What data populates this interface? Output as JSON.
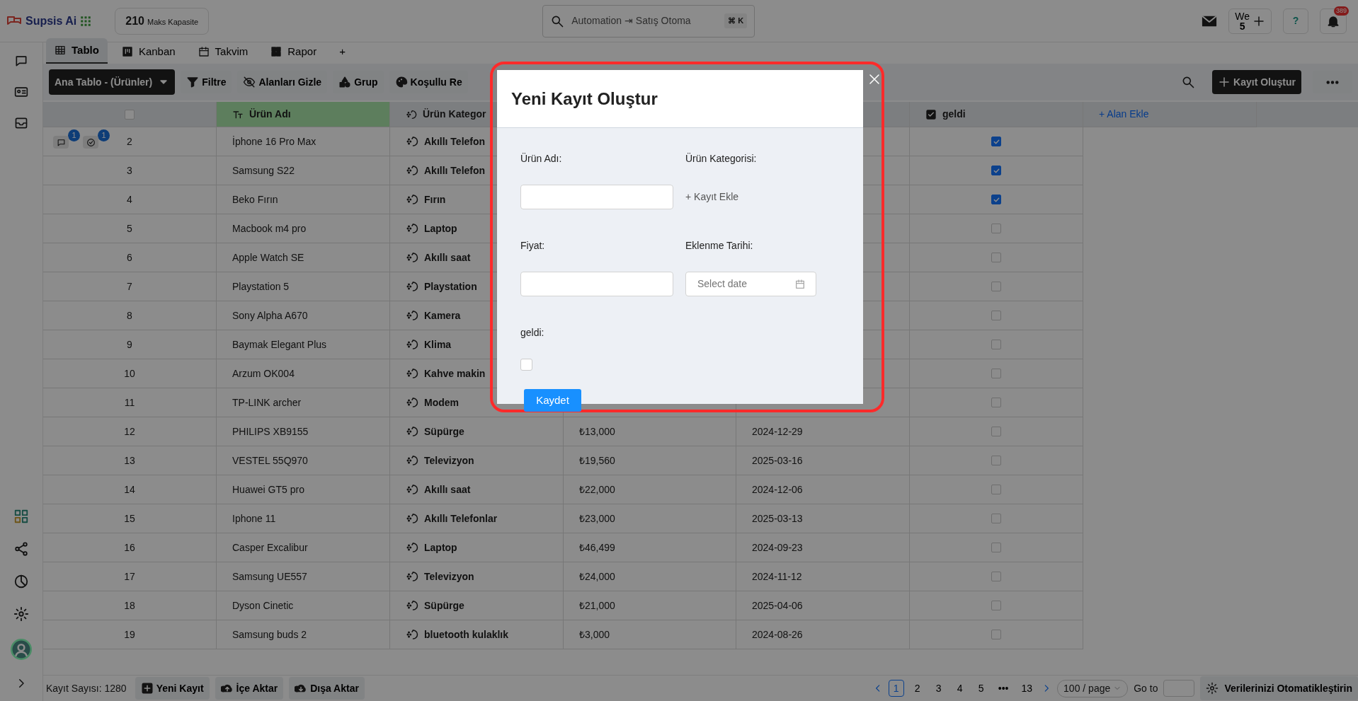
{
  "app": {
    "logo": "Supsis Ai",
    "capacity_value": "210",
    "capacity_label": "Maks Kapasite",
    "search_value": "Automation ⇥ Satış Otoma",
    "search_shortcut": "⌘ K",
    "user_initials": "We",
    "user_count": "5",
    "help": "?",
    "notifications": "389"
  },
  "view_tabs": [
    {
      "label": "Tablo",
      "selected": true
    },
    {
      "label": "Kanban",
      "selected": false
    },
    {
      "label": "Takvim",
      "selected": false
    },
    {
      "label": "Rapor",
      "selected": false
    }
  ],
  "add_tab": "+",
  "toolbar": {
    "table_select": "Ana Tablo - (Ürünler)",
    "buttons": [
      {
        "kind": "filter",
        "label": "Filtre"
      },
      {
        "kind": "hide",
        "label": "Alanları Gizle"
      },
      {
        "kind": "group",
        "label": "Grup"
      },
      {
        "kind": "color",
        "label": "Koşullu Re"
      }
    ],
    "create_button": "Kayıt Oluştur"
  },
  "table": {
    "select_all": {
      "checked": false
    },
    "columns": [
      {
        "label": "Ürün Adı",
        "highlighted": true
      },
      {
        "label": "Ürün Kategor",
        "highlighted": false
      },
      {
        "label": "geldi",
        "highlighted": false
      }
    ],
    "add_field": "+ Alan Ekle",
    "rows": [
      {
        "number": "2",
        "name": "İphone 16 Pro Max",
        "category": "Akıllı Telefon",
        "geldi": true,
        "comments": "1",
        "tasks": "1"
      },
      {
        "number": "3",
        "name": "Samsung S22",
        "category": "Akıllı Telefon",
        "geldi": true
      },
      {
        "number": "4",
        "name": "Beko Fırın",
        "category": "Fırın",
        "geldi": true
      },
      {
        "number": "5",
        "name": "Macbook m4 pro",
        "category": "Laptop",
        "geldi": false
      },
      {
        "number": "6",
        "name": "Apple Watch SE",
        "category": "Akıllı saat",
        "geldi": false
      },
      {
        "number": "7",
        "name": "Playstation 5",
        "category": "Playstation",
        "geldi": false
      },
      {
        "number": "8",
        "name": "Sony Alpha A670",
        "category": "Kamera",
        "geldi": false
      },
      {
        "number": "9",
        "name": "Baymak Elegant Plus",
        "category": "Klima",
        "geldi": false
      },
      {
        "number": "10",
        "name": "Arzum OK004",
        "category": "Kahve makin",
        "geldi": false
      },
      {
        "number": "11",
        "name": "TP-LINK archer",
        "category": "Modem",
        "geldi": false
      },
      {
        "number": "12",
        "name": "PHILIPS XB9155",
        "category": "Süpürge",
        "price": "₺13,000",
        "date": "2024-12-29",
        "geldi": false
      },
      {
        "number": "13",
        "name": "VESTEL 55Q970",
        "category": "Televizyon",
        "price": "₺19,560",
        "date": "2025-03-16",
        "geldi": false
      },
      {
        "number": "14",
        "name": "Huawei GT5 pro",
        "category": "Akıllı saat",
        "price": "₺22,000",
        "date": "2024-12-06",
        "geldi": false
      },
      {
        "number": "15",
        "name": "Iphone 11",
        "category": "Akıllı Telefonlar",
        "price": "₺23,000",
        "date": "2025-03-13",
        "geldi": false
      },
      {
        "number": "16",
        "name": "Casper Excalibur",
        "category": "Laptop",
        "price": "₺46,499",
        "date": "2024-09-23",
        "geldi": false
      },
      {
        "number": "17",
        "name": "Samsung UE557",
        "category": "Televizyon",
        "price": "₺24,000",
        "date": "2024-11-12",
        "geldi": false
      },
      {
        "number": "18",
        "name": "Dyson Cinetic",
        "category": "Süpürge",
        "price": "₺21,000",
        "date": "2025-04-06",
        "geldi": false
      },
      {
        "number": "19",
        "name": "Samsung buds 2",
        "category": "bluetooth kulaklık",
        "price": "₺3,000",
        "date": "2024-08-26",
        "geldi": false
      }
    ]
  },
  "footer": {
    "count": "Kayıt Sayısı: 1280",
    "buttons": [
      {
        "kind": "add",
        "label": "Yeni Kayıt"
      },
      {
        "kind": "import",
        "label": "İçe Aktar"
      },
      {
        "kind": "export",
        "label": "Dışa Aktar"
      }
    ],
    "pages": [
      {
        "label": "1",
        "selected": true
      },
      {
        "label": "2",
        "selected": false
      },
      {
        "label": "3",
        "selected": false
      },
      {
        "label": "4",
        "selected": false
      },
      {
        "label": "5",
        "selected": false
      },
      {
        "label": "•••",
        "selected": false
      },
      {
        "label": "13",
        "selected": false
      }
    ],
    "page_size": "100 / page",
    "goto_label": "Go to",
    "automate": "Verilerinizi Otomatikleştirin"
  },
  "modal": {
    "title": "Yeni Kayıt Oluştur",
    "fields": [
      {
        "kind": "text",
        "label": "Ürün Adı:"
      },
      {
        "kind": "link",
        "label": "Ürün Kategorisi:",
        "action": "+ Kayıt Ekle"
      },
      {
        "kind": "text",
        "label": "Fiyat:"
      },
      {
        "kind": "date",
        "label": "Eklenme Tarihi:",
        "placeholder": "Select date"
      },
      {
        "kind": "checkbox",
        "label": "geldi:",
        "checked": false
      }
    ],
    "save": "Kaydet"
  }
}
